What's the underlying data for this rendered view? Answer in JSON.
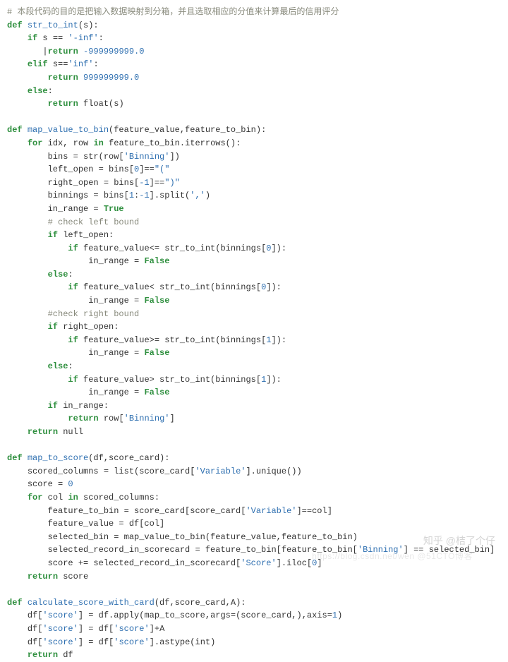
{
  "code": {
    "lines": [
      {
        "t": "cm",
        "txt": "# 本段代码的目的是把输入数据映射到分箱，并且选取相应的分值来计算最后的信用评分"
      },
      {
        "t": "l",
        "pre": "",
        "seg": [
          [
            "kw",
            "def"
          ],
          [
            "id",
            " "
          ],
          [
            "fn",
            "str_to_int"
          ],
          [
            "id",
            "(s):"
          ]
        ]
      },
      {
        "t": "l",
        "pre": "    ",
        "seg": [
          [
            "kw",
            "if"
          ],
          [
            "id",
            " s == "
          ],
          [
            "st",
            "'-inf'"
          ],
          [
            "id",
            ":"
          ]
        ]
      },
      {
        "t": "l",
        "pre": "       ",
        "seg": [
          [
            "id",
            "|"
          ],
          [
            "kw",
            "return"
          ],
          [
            "id",
            " "
          ],
          [
            "nm",
            "-999999999.0"
          ]
        ]
      },
      {
        "t": "l",
        "pre": "    ",
        "seg": [
          [
            "kw",
            "elif"
          ],
          [
            "id",
            " s=="
          ],
          [
            "st",
            "'inf'"
          ],
          [
            "id",
            ":"
          ]
        ]
      },
      {
        "t": "l",
        "pre": "        ",
        "seg": [
          [
            "kw",
            "return"
          ],
          [
            "id",
            " "
          ],
          [
            "nm",
            "999999999.0"
          ]
        ]
      },
      {
        "t": "l",
        "pre": "    ",
        "seg": [
          [
            "kw",
            "else"
          ],
          [
            "id",
            ":"
          ]
        ]
      },
      {
        "t": "l",
        "pre": "        ",
        "seg": [
          [
            "kw",
            "return"
          ],
          [
            "id",
            " float(s)"
          ]
        ]
      },
      {
        "t": "blank"
      },
      {
        "t": "l",
        "pre": "",
        "seg": [
          [
            "kw",
            "def"
          ],
          [
            "id",
            " "
          ],
          [
            "fn",
            "map_value_to_bin"
          ],
          [
            "id",
            "(feature_value,feature_to_bin):"
          ]
        ]
      },
      {
        "t": "l",
        "pre": "    ",
        "seg": [
          [
            "kw",
            "for"
          ],
          [
            "id",
            " idx, row "
          ],
          [
            "kw",
            "in"
          ],
          [
            "id",
            " feature_to_bin.iterrows():"
          ]
        ]
      },
      {
        "t": "l",
        "pre": "        ",
        "seg": [
          [
            "id",
            "bins = str(row["
          ],
          [
            "st",
            "'Binning'"
          ],
          [
            "id",
            "])"
          ]
        ]
      },
      {
        "t": "l",
        "pre": "        ",
        "seg": [
          [
            "id",
            "left_open = bins["
          ],
          [
            "nm",
            "0"
          ],
          [
            "id",
            "]=="
          ],
          [
            "st",
            "\"(\""
          ]
        ]
      },
      {
        "t": "l",
        "pre": "        ",
        "seg": [
          [
            "id",
            "right_open = bins["
          ],
          [
            "nm",
            "-1"
          ],
          [
            "id",
            "]=="
          ],
          [
            "st",
            "\")\""
          ]
        ]
      },
      {
        "t": "l",
        "pre": "        ",
        "seg": [
          [
            "id",
            "binnings = bins["
          ],
          [
            "nm",
            "1"
          ],
          [
            "id",
            ":"
          ],
          [
            "nm",
            "-1"
          ],
          [
            "id",
            "].split("
          ],
          [
            "st",
            "','"
          ],
          [
            "id",
            ")"
          ]
        ]
      },
      {
        "t": "l",
        "pre": "        ",
        "seg": [
          [
            "id",
            "in_range = "
          ],
          [
            "bt",
            "True"
          ]
        ]
      },
      {
        "t": "l",
        "pre": "        ",
        "seg": [
          [
            "cm",
            "# check left bound"
          ]
        ]
      },
      {
        "t": "l",
        "pre": "        ",
        "seg": [
          [
            "kw",
            "if"
          ],
          [
            "id",
            " left_open:"
          ]
        ]
      },
      {
        "t": "l",
        "pre": "            ",
        "seg": [
          [
            "kw",
            "if"
          ],
          [
            "id",
            " feature_value<= str_to_int(binnings["
          ],
          [
            "nm",
            "0"
          ],
          [
            "id",
            "]):"
          ]
        ]
      },
      {
        "t": "l",
        "pre": "                ",
        "seg": [
          [
            "id",
            "in_range = "
          ],
          [
            "bt",
            "False"
          ]
        ]
      },
      {
        "t": "l",
        "pre": "        ",
        "seg": [
          [
            "kw",
            "else"
          ],
          [
            "id",
            ":"
          ]
        ]
      },
      {
        "t": "l",
        "pre": "            ",
        "seg": [
          [
            "kw",
            "if"
          ],
          [
            "id",
            " feature_value< str_to_int(binnings["
          ],
          [
            "nm",
            "0"
          ],
          [
            "id",
            "]):"
          ]
        ]
      },
      {
        "t": "l",
        "pre": "                ",
        "seg": [
          [
            "id",
            "in_range = "
          ],
          [
            "bt",
            "False"
          ]
        ]
      },
      {
        "t": "l",
        "pre": "        ",
        "seg": [
          [
            "cm",
            "#check right bound"
          ]
        ]
      },
      {
        "t": "l",
        "pre": "        ",
        "seg": [
          [
            "kw",
            "if"
          ],
          [
            "id",
            " right_open:"
          ]
        ]
      },
      {
        "t": "l",
        "pre": "            ",
        "seg": [
          [
            "kw",
            "if"
          ],
          [
            "id",
            " feature_value>= str_to_int(binnings["
          ],
          [
            "nm",
            "1"
          ],
          [
            "id",
            "]):"
          ]
        ]
      },
      {
        "t": "l",
        "pre": "                ",
        "seg": [
          [
            "id",
            "in_range = "
          ],
          [
            "bt",
            "False"
          ]
        ]
      },
      {
        "t": "l",
        "pre": "        ",
        "seg": [
          [
            "kw",
            "else"
          ],
          [
            "id",
            ":"
          ]
        ]
      },
      {
        "t": "l",
        "pre": "            ",
        "seg": [
          [
            "kw",
            "if"
          ],
          [
            "id",
            " feature_value> str_to_int(binnings["
          ],
          [
            "nm",
            "1"
          ],
          [
            "id",
            "]):"
          ]
        ]
      },
      {
        "t": "l",
        "pre": "                ",
        "seg": [
          [
            "id",
            "in_range = "
          ],
          [
            "bt",
            "False"
          ]
        ]
      },
      {
        "t": "l",
        "pre": "        ",
        "seg": [
          [
            "kw",
            "if"
          ],
          [
            "id",
            " in_range:"
          ]
        ]
      },
      {
        "t": "l",
        "pre": "            ",
        "seg": [
          [
            "kw",
            "return"
          ],
          [
            "id",
            " row["
          ],
          [
            "st",
            "'Binning'"
          ],
          [
            "id",
            "]"
          ]
        ]
      },
      {
        "t": "l",
        "pre": "    ",
        "seg": [
          [
            "kw",
            "return"
          ],
          [
            "id",
            " null"
          ]
        ]
      },
      {
        "t": "blank"
      },
      {
        "t": "l",
        "pre": "",
        "seg": [
          [
            "kw",
            "def"
          ],
          [
            "id",
            " "
          ],
          [
            "fn",
            "map_to_score"
          ],
          [
            "id",
            "(df,score_card):"
          ]
        ]
      },
      {
        "t": "l",
        "pre": "    ",
        "seg": [
          [
            "id",
            "scored_columns = list(score_card["
          ],
          [
            "st",
            "'Variable'"
          ],
          [
            "id",
            "].unique())"
          ]
        ]
      },
      {
        "t": "l",
        "pre": "    ",
        "seg": [
          [
            "id",
            "score = "
          ],
          [
            "nm",
            "0"
          ]
        ]
      },
      {
        "t": "l",
        "pre": "    ",
        "seg": [
          [
            "kw",
            "for"
          ],
          [
            "id",
            " col "
          ],
          [
            "kw",
            "in"
          ],
          [
            "id",
            " scored_columns:"
          ]
        ]
      },
      {
        "t": "l",
        "pre": "        ",
        "seg": [
          [
            "id",
            "feature_to_bin = score_card[score_card["
          ],
          [
            "st",
            "'Variable'"
          ],
          [
            "id",
            "]==col]"
          ]
        ]
      },
      {
        "t": "l",
        "pre": "        ",
        "seg": [
          [
            "id",
            "feature_value = df[col]"
          ]
        ]
      },
      {
        "t": "l",
        "pre": "        ",
        "seg": [
          [
            "id",
            "selected_bin = map_value_to_bin(feature_value,feature_to_bin)"
          ]
        ]
      },
      {
        "t": "l",
        "pre": "        ",
        "seg": [
          [
            "id",
            "selected_record_in_scorecard = feature_to_bin[feature_to_bin["
          ],
          [
            "st",
            "'Binning'"
          ],
          [
            "id",
            "] == selected_bin]"
          ]
        ]
      },
      {
        "t": "l",
        "pre": "        ",
        "seg": [
          [
            "id",
            "score += selected_record_in_scorecard["
          ],
          [
            "st",
            "'Score'"
          ],
          [
            "id",
            "].iloc["
          ],
          [
            "nm",
            "0"
          ],
          [
            "id",
            "]"
          ]
        ]
      },
      {
        "t": "l",
        "pre": "    ",
        "seg": [
          [
            "kw",
            "return"
          ],
          [
            "id",
            " score"
          ]
        ]
      },
      {
        "t": "blank"
      },
      {
        "t": "l",
        "pre": "",
        "seg": [
          [
            "kw",
            "def"
          ],
          [
            "id",
            " "
          ],
          [
            "fn",
            "calculate_score_with_card"
          ],
          [
            "id",
            "(df,score_card,A):"
          ]
        ]
      },
      {
        "t": "l",
        "pre": "    ",
        "seg": [
          [
            "id",
            "df["
          ],
          [
            "st",
            "'score'"
          ],
          [
            "id",
            "] = df.apply(map_to_score,args=(score_card,),axis="
          ],
          [
            "nm",
            "1"
          ],
          [
            "id",
            ")"
          ]
        ]
      },
      {
        "t": "l",
        "pre": "    ",
        "seg": [
          [
            "id",
            "df["
          ],
          [
            "st",
            "'score'"
          ],
          [
            "id",
            "] = df["
          ],
          [
            "st",
            "'score'"
          ],
          [
            "id",
            "]+A"
          ]
        ]
      },
      {
        "t": "l",
        "pre": "    ",
        "seg": [
          [
            "id",
            "df["
          ],
          [
            "st",
            "'score'"
          ],
          [
            "id",
            "] = df["
          ],
          [
            "st",
            "'score'"
          ],
          [
            "id",
            "].astype(int)"
          ]
        ]
      },
      {
        "t": "l",
        "pre": "    ",
        "seg": [
          [
            "kw",
            "return"
          ],
          [
            "id",
            " df"
          ]
        ]
      }
    ]
  },
  "watermark": "知乎 @桔了个仔",
  "watermark2": "https://blog.csdn.net/wen   @51CTO博客"
}
